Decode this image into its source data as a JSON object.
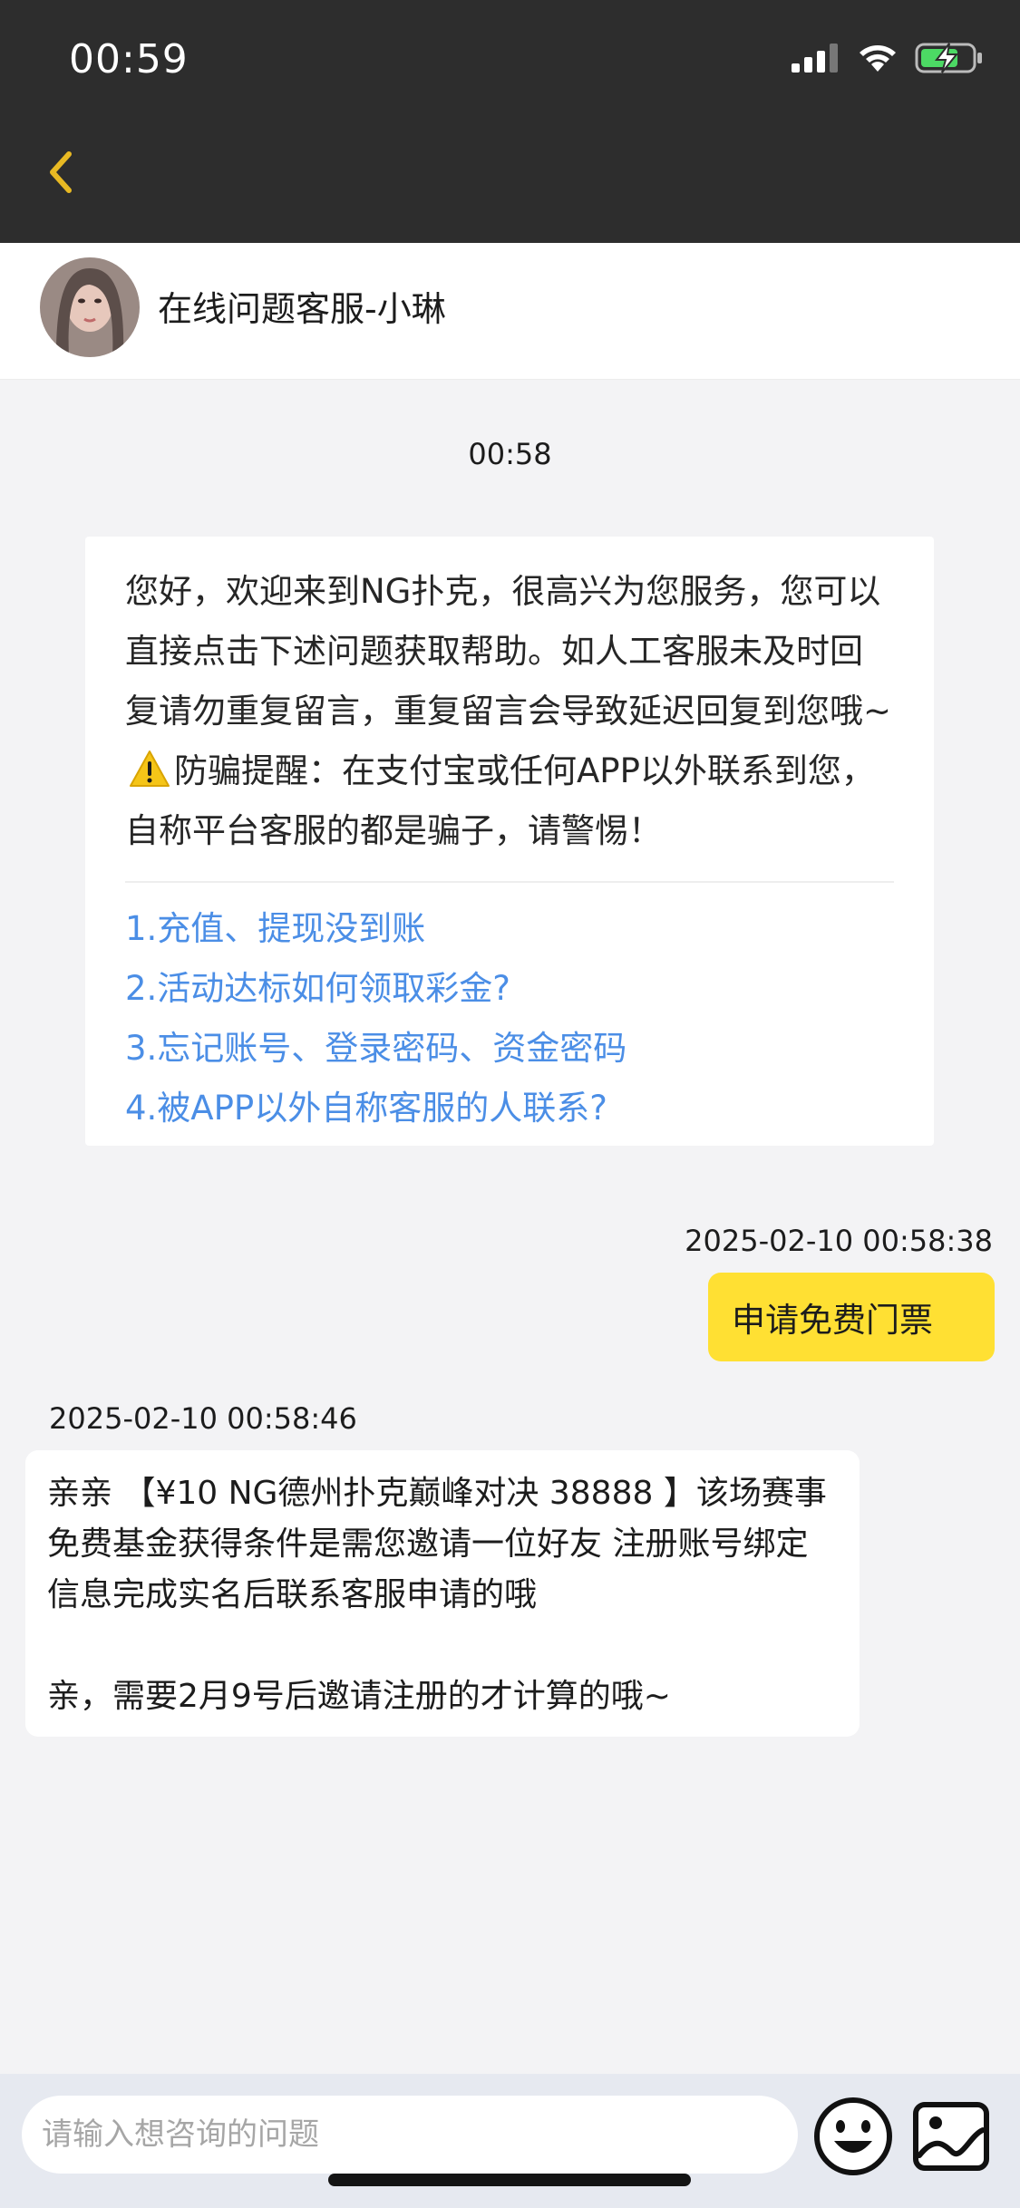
{
  "status_bar": {
    "time": "00:59",
    "icons": [
      "signal-icon",
      "wifi-icon",
      "battery-charging-icon"
    ]
  },
  "nav": {
    "back_icon": "chevron-left-icon",
    "accent_color": "#e8b923"
  },
  "agent": {
    "name": "在线问题客服-小琳",
    "avatar": "agent-avatar"
  },
  "chat": {
    "start_time": "00:58",
    "welcome": {
      "text_before_warning": "您好，欢迎来到NG扑克，很高兴为您服务，您可以直接点击下述问题获取帮助。如人工客服未及时回复请勿重复留言，重复留言会导致延迟回复到您哦~",
      "warning_icon": "warning-icon",
      "text_after_warning": "防骗提醒：在支付宝或任何APP以外联系到您，自称平台客服的都是骗子，请警惕！",
      "faq": [
        "1.充值、提现没到账",
        "2.活动达标如何领取彩金?",
        "3.忘记账号、登录密码、资金密码",
        "4.被APP以外自称客服的人联系?"
      ],
      "link_color": "#4b8ee6"
    },
    "user_message": {
      "timestamp": "2025-02-10 00:58:38",
      "text": "申请免费门票",
      "bubble_color": "#ffe033"
    },
    "agent_reply": {
      "timestamp": "2025-02-10 00:58:46",
      "paragraph1": "亲亲 【¥10 NG德州扑克巅峰对决 38888 】该场赛事免费基金获得条件是需您邀请一位好友 注册账号绑定信息完成实名后联系客服申请的哦",
      "paragraph2": "亲，需要2月9号后邀请注册的才计算的哦~"
    }
  },
  "input_bar": {
    "placeholder": "请输入想咨询的问题",
    "emoji_icon": "emoji-icon",
    "image_icon": "image-icon"
  }
}
